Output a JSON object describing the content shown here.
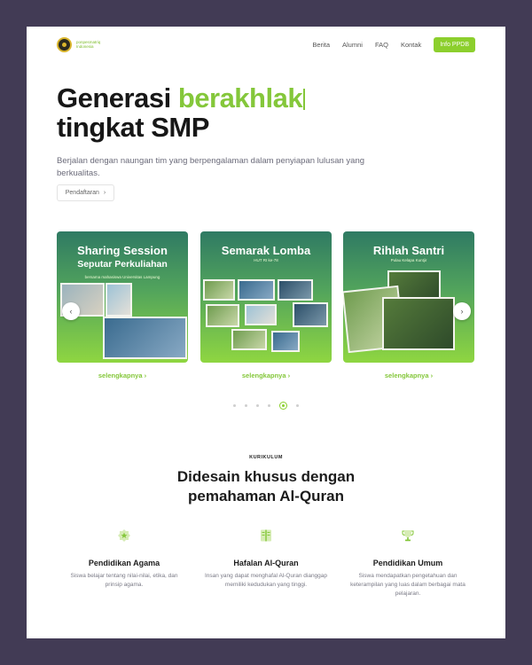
{
  "brand": {
    "name_line1": "ponpesmatriq",
    "name_line2": "Indonesia"
  },
  "nav": {
    "links": [
      "Berita",
      "Alumni",
      "FAQ",
      "Kontak"
    ],
    "cta": "Info PPDB"
  },
  "hero": {
    "title_word1": "Generasi",
    "title_highlight": "berakhlak",
    "title_line2": "tingkat SMP",
    "subtitle": "Berjalan dengan naungan tim yang berpengalaman dalam penyiapan lulusan yang berkualitas.",
    "button": "Pendaftaran"
  },
  "carousel": {
    "cards": [
      {
        "title": "Sharing Session",
        "subtitle": "Seputar Perkuliahan",
        "caption": "bersama mahasiswa Universitas Lampung",
        "link": "selengkapnya"
      },
      {
        "title": "Semarak Lomba",
        "caption": "HUT RI ke-78",
        "link": "selengkapnya"
      },
      {
        "title": "Rihlah Santri",
        "caption": "Pulau Kelapa Kuntjir",
        "link": "selengkapnya"
      }
    ],
    "dot_count": 6,
    "active_dot": 4,
    "arrow_prev": "‹",
    "arrow_next": "›"
  },
  "curriculum": {
    "kicker": "KURIKULUM",
    "title_line1": "Didesain khusus dengan",
    "title_line2": "pemahaman Al-Quran",
    "features": [
      {
        "icon": "badge-star-icon",
        "title": "Pendidikan Agama",
        "description": "Siswa belajar tentang nilai-nilai, etika, dan prinsip agama."
      },
      {
        "icon": "quran-book-icon",
        "title": "Hafalan Al-Quran",
        "description": "Insan yang dapat menghafal Al-Quran dianggap memiliki kedudukan yang tinggi."
      },
      {
        "icon": "trophy-icon",
        "title": "Pendidikan Umum",
        "description": "Siswa mendapatkan pengetahuan dan keterampilan yang luas dalam berbagai mata pelajaran."
      }
    ]
  },
  "colors": {
    "accent": "#8ccf2d",
    "frame": "#423b55",
    "text": "#1c1c1c"
  }
}
